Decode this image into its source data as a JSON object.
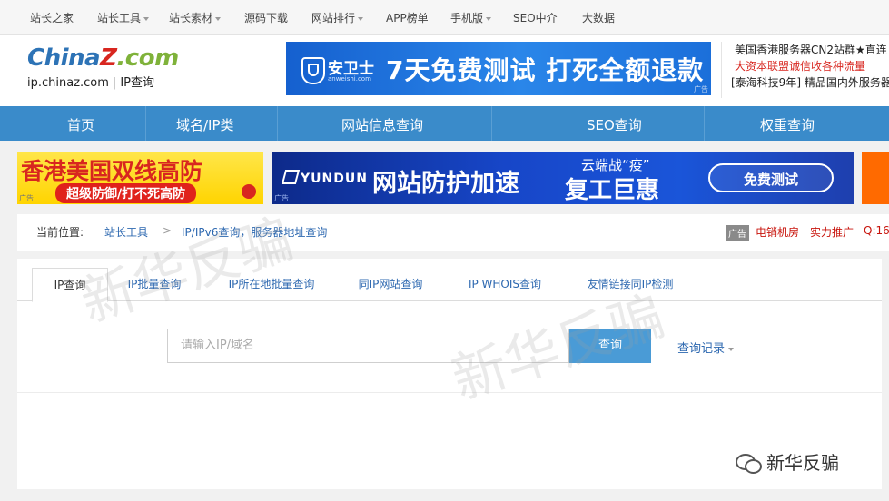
{
  "topnav": {
    "items": [
      "站长之家",
      "站长工具",
      "站长素材",
      "源码下载",
      "网站排行",
      "APP榜单",
      "手机版",
      "SEO中介",
      "大数据"
    ]
  },
  "header": {
    "logo_brand_a": "China",
    "logo_brand_z": "Z",
    "logo_brand_b": ".com",
    "logo_domain": "ip.chinaz.com",
    "logo_section": "IP查询",
    "banner": {
      "brand": "安卫士",
      "brand_sub": "anweishi.com",
      "slogan": "7天免费测试  打死全额退款",
      "ad_label": "广告"
    },
    "side_ad": {
      "line1": "美国香港服务器CN2站群★直连",
      "line2": "大资本联盟诚信收各种流量",
      "line3": "[泰海科技9年] 精品国内外服务器"
    }
  },
  "mainnav": {
    "items": [
      "首页",
      "域名/IP类",
      "网站信息查询",
      "SEO查询",
      "权重查询"
    ]
  },
  "ads": {
    "hk_title": "香港美国双线高防",
    "hk_sub": "超级防御/打不死高防",
    "hk_ad_label": "广告",
    "yundun_brand": "YUNDUN",
    "yundun_slogan": "网站防护加速",
    "yundun_line1": "云端战“疫”",
    "yundun_line2": "复工巨惠",
    "yundun_button": "免费测试",
    "yundun_ad_label": "广告"
  },
  "breadcrumb": {
    "prefix": "当前位置:",
    "level1": "站长工具",
    "sep": ">",
    "level2": "IP/IPv6查询，服务器地址查询",
    "ad_tag": "广告",
    "ad_link1": "电销机房",
    "ad_link2": "实力推广",
    "ad_link3": "Q:16"
  },
  "tabs": [
    "IP查询",
    "IP批量查询",
    "IP所在地批量查询",
    "同IP网站查询",
    "IP WHOIS查询",
    "友情链接同IP检测"
  ],
  "search": {
    "placeholder": "请输入IP/域名",
    "button": "查询",
    "history": "查询记录"
  },
  "watermark": {
    "text": "新华反骗",
    "account": "新华反骗"
  },
  "colors": {
    "nav_blue": "#3a8bca",
    "link_blue": "#2d68b0",
    "button_blue": "#4a9bd6",
    "ad_red": "#c8140c"
  }
}
